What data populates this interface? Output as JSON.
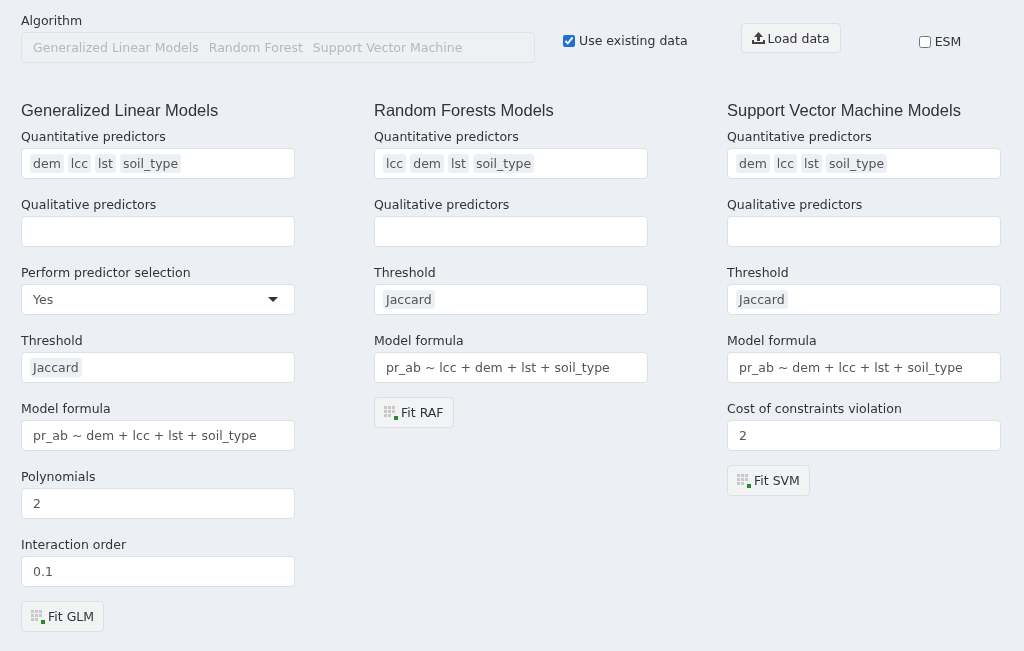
{
  "algorithm": {
    "label": "Algorithm",
    "disabled": true,
    "tags": [
      "Generalized Linear Models",
      "Random Forest",
      "Support Vector Machine"
    ]
  },
  "use_existing_data": {
    "label": "Use existing data",
    "checked": true
  },
  "load_button": {
    "label": "Load data"
  },
  "esm": {
    "label": "ESM",
    "checked": false
  },
  "panels": [
    {
      "title": "Generalized Linear Models",
      "button": "Fit GLM",
      "fields": [
        {
          "kind": "tags",
          "label": "Quantitative predictors",
          "tags": [
            "dem",
            "lcc",
            "lst",
            "soil_type"
          ]
        },
        {
          "kind": "text",
          "label": "Qualitative predictors"
        },
        {
          "kind": "select",
          "label": "Perform predictor selection",
          "value": "Yes"
        },
        {
          "kind": "tags",
          "label": "Threshold",
          "tags": [
            "Jaccard"
          ]
        },
        {
          "kind": "text",
          "label": "Model formula",
          "value": "pr_ab ~ dem + lcc + lst + soil_type"
        },
        {
          "kind": "text",
          "label": "Polynomials",
          "value": "2"
        },
        {
          "kind": "text",
          "label": "Interaction order",
          "value": "0.1"
        }
      ]
    },
    {
      "title": "Random Forests Models",
      "button": "Fit RAF",
      "fields": [
        {
          "kind": "tags",
          "label": "Quantitative predictors",
          "tags": [
            "lcc",
            "dem",
            "lst",
            "soil_type"
          ]
        },
        {
          "kind": "text",
          "label": "Qualitative predictors"
        },
        {
          "kind": "tags",
          "label": "Threshold",
          "tags": [
            "Jaccard"
          ]
        },
        {
          "kind": "text",
          "label": "Model formula",
          "value": "pr_ab ~ lcc + dem + lst + soil_type"
        }
      ]
    },
    {
      "title": "Support Vector Machine Models",
      "button": "Fit SVM",
      "fields": [
        {
          "kind": "tags",
          "label": "Quantitative predictors",
          "tags": [
            "dem",
            "lcc",
            "lst",
            "soil_type"
          ]
        },
        {
          "kind": "text",
          "label": "Qualitative predictors"
        },
        {
          "kind": "tags",
          "label": "Threshold",
          "tags": [
            "Jaccard"
          ]
        },
        {
          "kind": "text",
          "label": "Model formula",
          "value": "pr_ab ~ dem + lcc + lst + soil_type"
        },
        {
          "kind": "text",
          "label": "Cost of constraints violation",
          "value": "2"
        }
      ]
    }
  ]
}
